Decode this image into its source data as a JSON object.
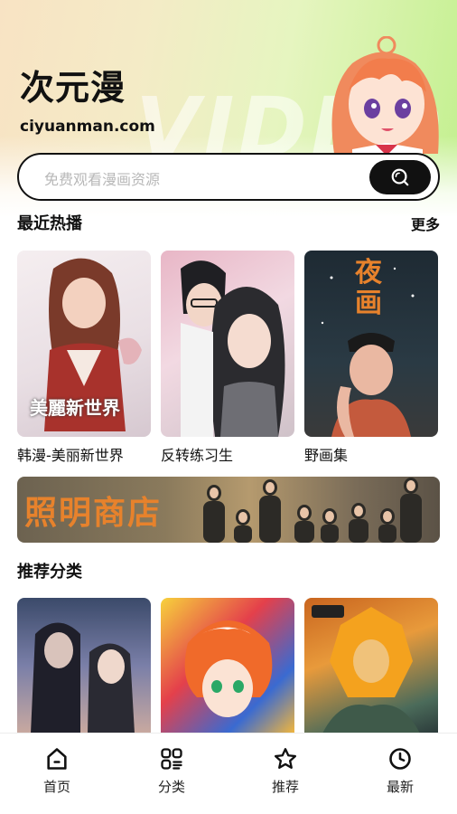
{
  "header": {
    "title": "次元漫",
    "domain": "ciyuanman.com",
    "watermark": "VIDEO"
  },
  "search": {
    "placeholder": "免费观看漫画资源",
    "icon": "search-icon"
  },
  "recent": {
    "title": "最近热播",
    "more_label": "更多",
    "items": [
      {
        "label": "韩漫-美丽新世界",
        "cover_text": "美麗新世界"
      },
      {
        "label": "反转练习生"
      },
      {
        "label": "野画集",
        "cover_text": "夜画"
      }
    ]
  },
  "banner": {
    "text": "照明商店"
  },
  "recommend": {
    "title": "推荐分类"
  },
  "tabbar": {
    "items": [
      {
        "label": "首页",
        "icon": "home-icon"
      },
      {
        "label": "分类",
        "icon": "category-icon"
      },
      {
        "label": "推荐",
        "icon": "star-icon"
      },
      {
        "label": "最新",
        "icon": "clock-icon"
      }
    ]
  },
  "colors": {
    "accent": "#111111",
    "header_gradient_start": "#f8e3c4",
    "header_gradient_end": "#c3f08f",
    "banner_text": "#e7822c"
  }
}
